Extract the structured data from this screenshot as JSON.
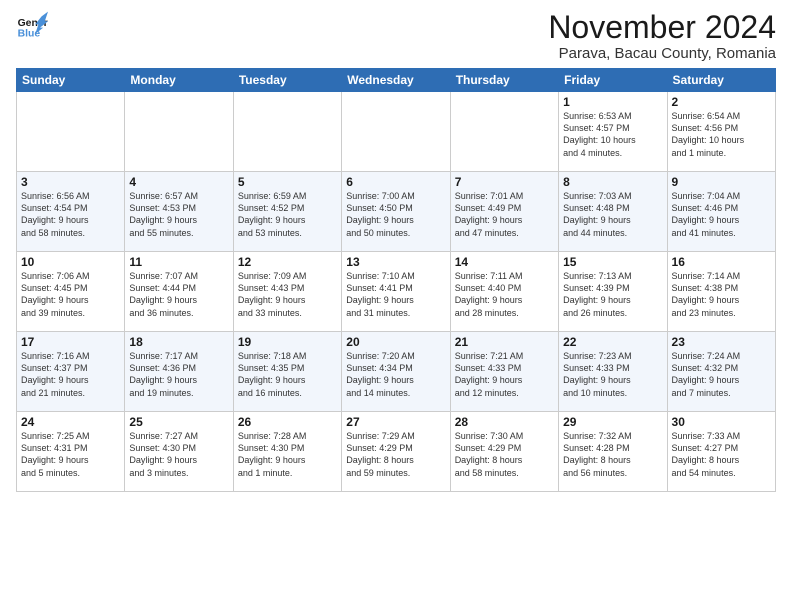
{
  "logo": {
    "line1": "General",
    "line2": "Blue"
  },
  "title": "November 2024",
  "subtitle": "Parava, Bacau County, Romania",
  "weekdays": [
    "Sunday",
    "Monday",
    "Tuesday",
    "Wednesday",
    "Thursday",
    "Friday",
    "Saturday"
  ],
  "weeks": [
    [
      {
        "day": "",
        "info": ""
      },
      {
        "day": "",
        "info": ""
      },
      {
        "day": "",
        "info": ""
      },
      {
        "day": "",
        "info": ""
      },
      {
        "day": "",
        "info": ""
      },
      {
        "day": "1",
        "info": "Sunrise: 6:53 AM\nSunset: 4:57 PM\nDaylight: 10 hours\nand 4 minutes."
      },
      {
        "day": "2",
        "info": "Sunrise: 6:54 AM\nSunset: 4:56 PM\nDaylight: 10 hours\nand 1 minute."
      }
    ],
    [
      {
        "day": "3",
        "info": "Sunrise: 6:56 AM\nSunset: 4:54 PM\nDaylight: 9 hours\nand 58 minutes."
      },
      {
        "day": "4",
        "info": "Sunrise: 6:57 AM\nSunset: 4:53 PM\nDaylight: 9 hours\nand 55 minutes."
      },
      {
        "day": "5",
        "info": "Sunrise: 6:59 AM\nSunset: 4:52 PM\nDaylight: 9 hours\nand 53 minutes."
      },
      {
        "day": "6",
        "info": "Sunrise: 7:00 AM\nSunset: 4:50 PM\nDaylight: 9 hours\nand 50 minutes."
      },
      {
        "day": "7",
        "info": "Sunrise: 7:01 AM\nSunset: 4:49 PM\nDaylight: 9 hours\nand 47 minutes."
      },
      {
        "day": "8",
        "info": "Sunrise: 7:03 AM\nSunset: 4:48 PM\nDaylight: 9 hours\nand 44 minutes."
      },
      {
        "day": "9",
        "info": "Sunrise: 7:04 AM\nSunset: 4:46 PM\nDaylight: 9 hours\nand 41 minutes."
      }
    ],
    [
      {
        "day": "10",
        "info": "Sunrise: 7:06 AM\nSunset: 4:45 PM\nDaylight: 9 hours\nand 39 minutes."
      },
      {
        "day": "11",
        "info": "Sunrise: 7:07 AM\nSunset: 4:44 PM\nDaylight: 9 hours\nand 36 minutes."
      },
      {
        "day": "12",
        "info": "Sunrise: 7:09 AM\nSunset: 4:43 PM\nDaylight: 9 hours\nand 33 minutes."
      },
      {
        "day": "13",
        "info": "Sunrise: 7:10 AM\nSunset: 4:41 PM\nDaylight: 9 hours\nand 31 minutes."
      },
      {
        "day": "14",
        "info": "Sunrise: 7:11 AM\nSunset: 4:40 PM\nDaylight: 9 hours\nand 28 minutes."
      },
      {
        "day": "15",
        "info": "Sunrise: 7:13 AM\nSunset: 4:39 PM\nDaylight: 9 hours\nand 26 minutes."
      },
      {
        "day": "16",
        "info": "Sunrise: 7:14 AM\nSunset: 4:38 PM\nDaylight: 9 hours\nand 23 minutes."
      }
    ],
    [
      {
        "day": "17",
        "info": "Sunrise: 7:16 AM\nSunset: 4:37 PM\nDaylight: 9 hours\nand 21 minutes."
      },
      {
        "day": "18",
        "info": "Sunrise: 7:17 AM\nSunset: 4:36 PM\nDaylight: 9 hours\nand 19 minutes."
      },
      {
        "day": "19",
        "info": "Sunrise: 7:18 AM\nSunset: 4:35 PM\nDaylight: 9 hours\nand 16 minutes."
      },
      {
        "day": "20",
        "info": "Sunrise: 7:20 AM\nSunset: 4:34 PM\nDaylight: 9 hours\nand 14 minutes."
      },
      {
        "day": "21",
        "info": "Sunrise: 7:21 AM\nSunset: 4:33 PM\nDaylight: 9 hours\nand 12 minutes."
      },
      {
        "day": "22",
        "info": "Sunrise: 7:23 AM\nSunset: 4:33 PM\nDaylight: 9 hours\nand 10 minutes."
      },
      {
        "day": "23",
        "info": "Sunrise: 7:24 AM\nSunset: 4:32 PM\nDaylight: 9 hours\nand 7 minutes."
      }
    ],
    [
      {
        "day": "24",
        "info": "Sunrise: 7:25 AM\nSunset: 4:31 PM\nDaylight: 9 hours\nand 5 minutes."
      },
      {
        "day": "25",
        "info": "Sunrise: 7:27 AM\nSunset: 4:30 PM\nDaylight: 9 hours\nand 3 minutes."
      },
      {
        "day": "26",
        "info": "Sunrise: 7:28 AM\nSunset: 4:30 PM\nDaylight: 9 hours\nand 1 minute."
      },
      {
        "day": "27",
        "info": "Sunrise: 7:29 AM\nSunset: 4:29 PM\nDaylight: 8 hours\nand 59 minutes."
      },
      {
        "day": "28",
        "info": "Sunrise: 7:30 AM\nSunset: 4:29 PM\nDaylight: 8 hours\nand 58 minutes."
      },
      {
        "day": "29",
        "info": "Sunrise: 7:32 AM\nSunset: 4:28 PM\nDaylight: 8 hours\nand 56 minutes."
      },
      {
        "day": "30",
        "info": "Sunrise: 7:33 AM\nSunset: 4:27 PM\nDaylight: 8 hours\nand 54 minutes."
      }
    ]
  ]
}
